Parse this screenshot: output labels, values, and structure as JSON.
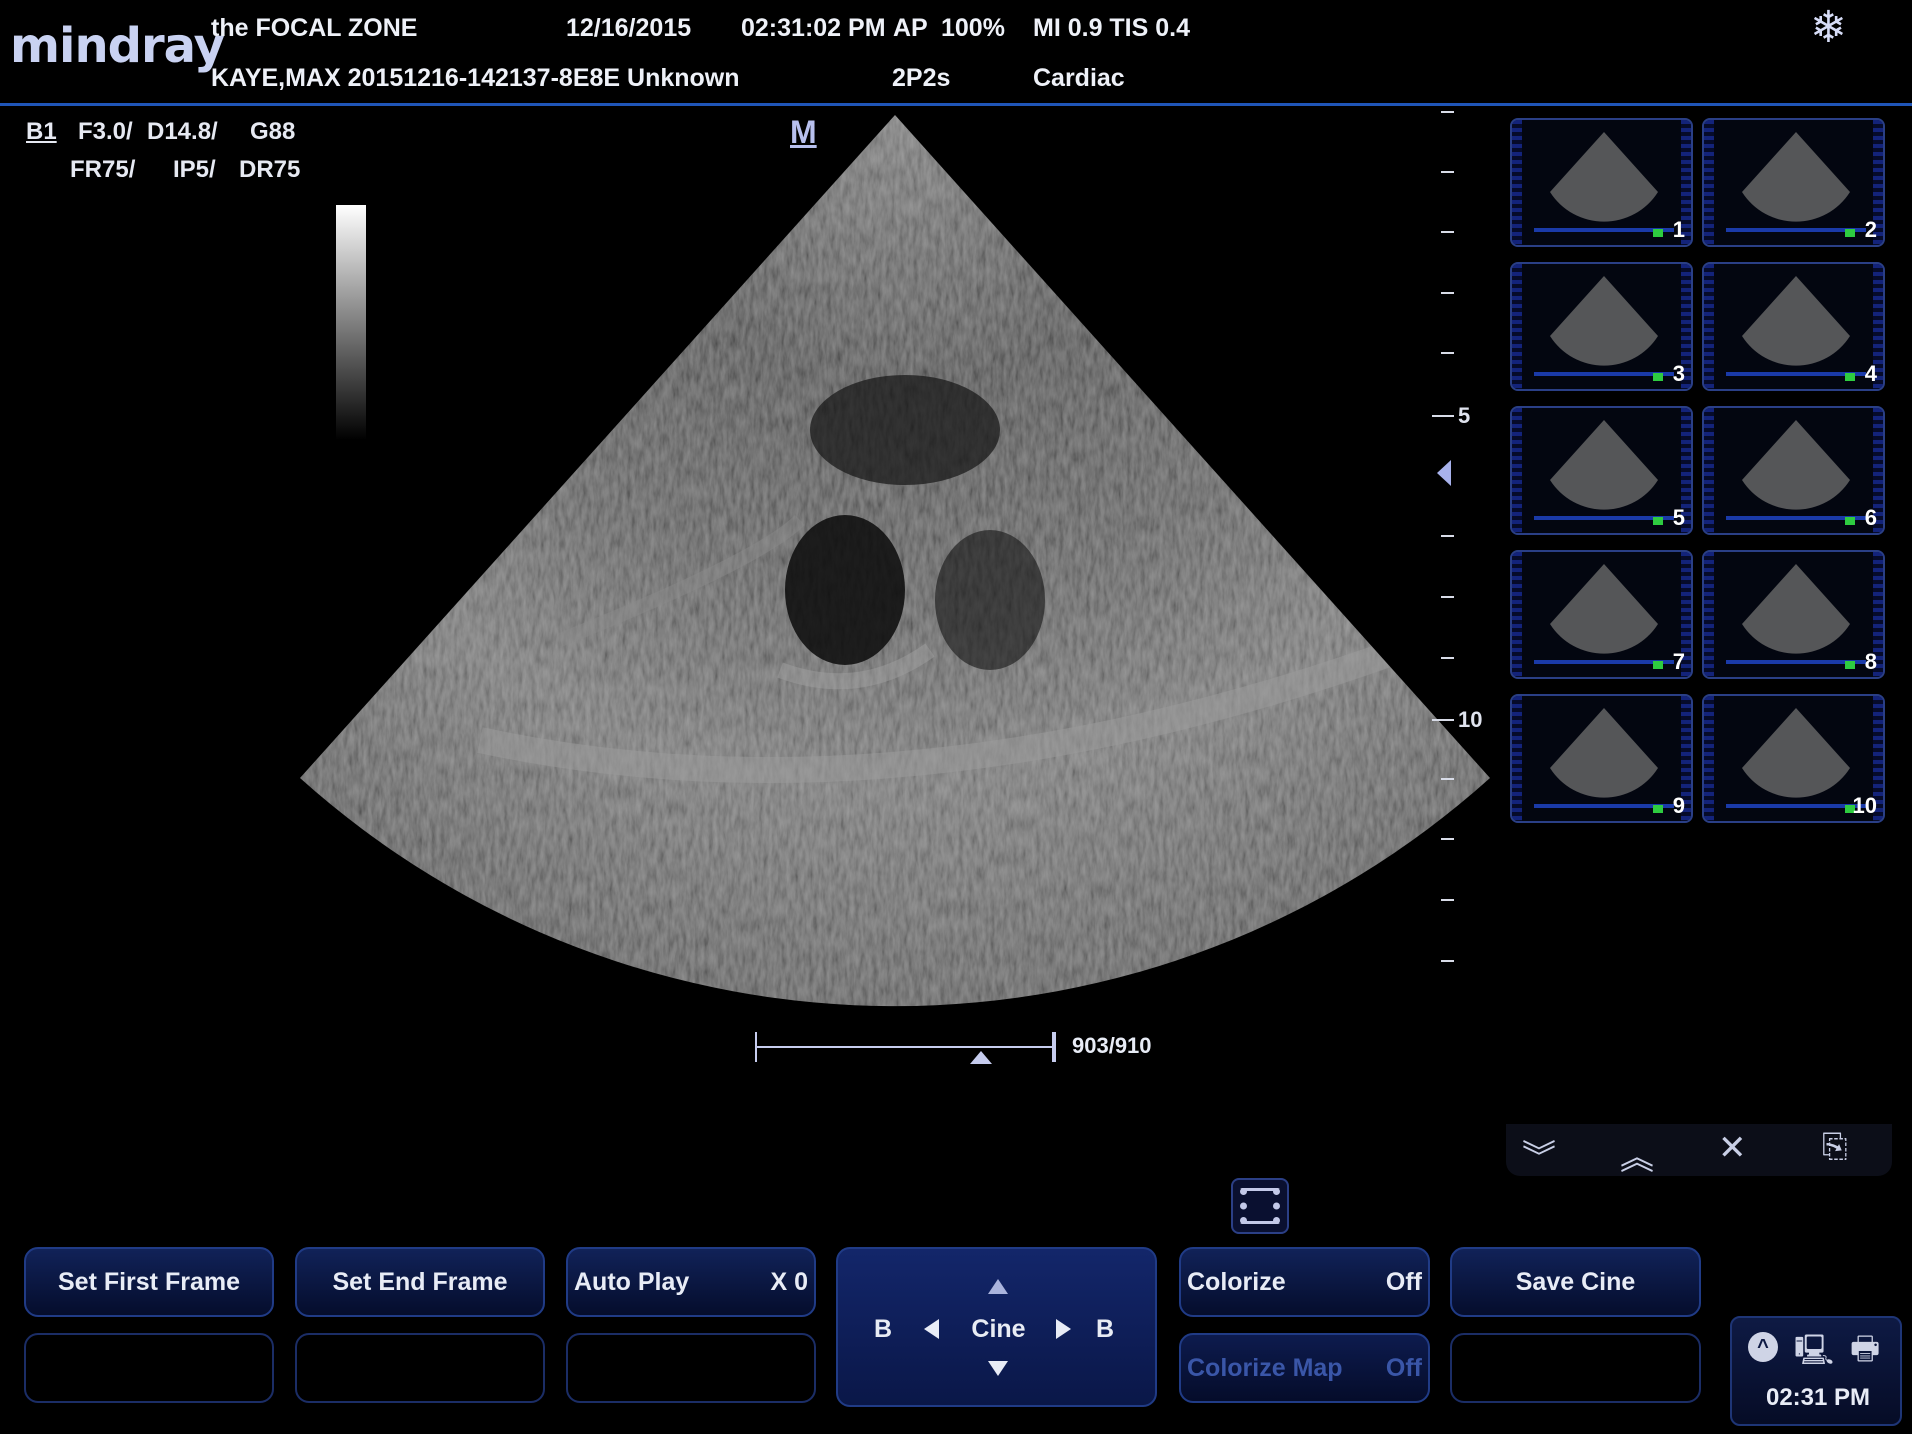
{
  "header": {
    "logo": "mindray",
    "hospital": "the FOCAL ZONE",
    "date": "12/16/2015",
    "time": "02:31:02 PM",
    "ap_label": "AP",
    "ap_value": "100%",
    "mi_tis": "MI 0.9 TIS 0.4",
    "patient": "KAYE,MAX 20151216-142137-8E8E Unknown",
    "probe": "2P2s",
    "exam": "Cardiac",
    "freeze_icon": "snowflake-icon"
  },
  "params": {
    "mode": "B1",
    "freq": "F3.0/",
    "depth": "D14.8/",
    "gain": "G88",
    "frame_rate": "FR75/",
    "ip": "IP5/",
    "dynamic_range": "DR75",
    "orientation_mark": "M"
  },
  "depth_scale": {
    "label_5": "5",
    "label_10": "10"
  },
  "cine": {
    "frame_readout": "903/910",
    "position_fraction": 0.75
  },
  "thumbnails": [
    {
      "num": "1"
    },
    {
      "num": "2"
    },
    {
      "num": "3"
    },
    {
      "num": "4"
    },
    {
      "num": "5"
    },
    {
      "num": "6"
    },
    {
      "num": "7"
    },
    {
      "num": "8"
    },
    {
      "num": "9"
    },
    {
      "num": "10"
    }
  ],
  "thumb_tools": [
    "page-down-icon",
    "page-up-icon",
    "delete-icon",
    "send-icon"
  ],
  "menu": {
    "set_first_frame": "Set First Frame",
    "set_end_frame": "Set End Frame",
    "auto_play": "Auto Play",
    "auto_play_value": "X 0",
    "cine_left": "B",
    "cine_label": "Cine",
    "cine_right": "B",
    "colorize": "Colorize",
    "colorize_value": "Off",
    "colorize_map": "Colorize Map",
    "colorize_map_value": "Off",
    "save_cine": "Save Cine"
  },
  "status": {
    "clock": "02:31 PM"
  },
  "colors": {
    "accent": "#1f55b8",
    "button_border": "#203b86",
    "text": "#e8ecf4"
  }
}
